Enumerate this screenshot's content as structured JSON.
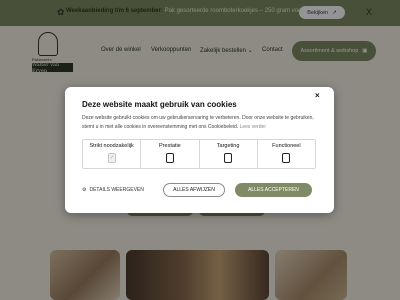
{
  "announcement": {
    "bold_text": "Weekaanbieding t/m 6 september:",
    "text": "Pak gesorteerde roomboterkoekjes – 250 gram voor €6,",
    "button_label": "Bekijken",
    "button_icon": "arrow-up-right-icon",
    "close_label": "X"
  },
  "logo": {
    "label_top": "Patisserie",
    "label_name": "Walter van Erven"
  },
  "nav": {
    "items": [
      {
        "label": "Over de winkel"
      },
      {
        "label": "Verkooppunten"
      },
      {
        "label": "Zakelijk bestellen"
      },
      {
        "label": "Contact"
      }
    ],
    "shop_button": "Assortiment & webshop"
  },
  "cookie_modal": {
    "title": "Deze website maakt gebruik van cookies",
    "description": "Deze website gebruikt cookies om uw gebruikerservaring te verbeteren. Door onze website te gebruiken, stemt u in met alle cookies in overeenstemming met ons Cookiebeleid.",
    "read_more": "Lees verder",
    "close_label": "×",
    "categories": [
      {
        "label": "Strikt noodzakelijk",
        "checked": true
      },
      {
        "label": "Prestatie",
        "checked": false
      },
      {
        "label": "Targeting",
        "checked": false
      },
      {
        "label": "Functioneel",
        "checked": false
      }
    ],
    "details_label": "DETAILS WEERGEVEN",
    "reject_label": "ALLES AFWIJZEN",
    "accept_label": "ALLES ACCEPTEREN"
  },
  "colors": {
    "accent": "#7f8b65",
    "dark": "#2f3a26",
    "background": "#f4f0e6"
  }
}
